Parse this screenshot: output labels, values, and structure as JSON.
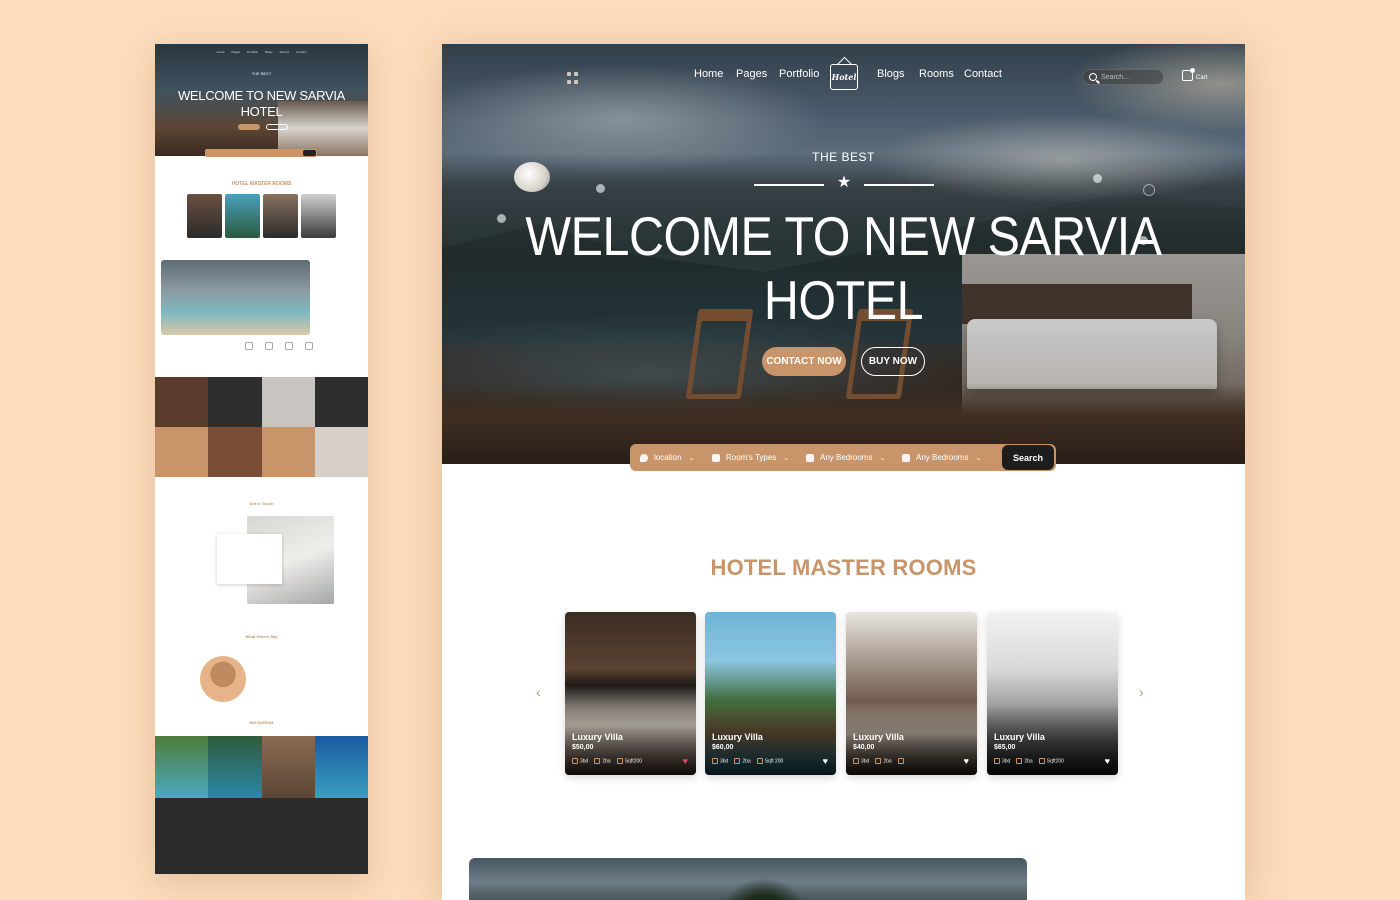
{
  "nav": {
    "links": [
      "Home",
      "Pages",
      "Portfolio",
      "Blogs",
      "Rooms",
      "Contact"
    ],
    "logo": "Hotel",
    "search_placeholder": "Search...",
    "cart_label": "Cart"
  },
  "hero": {
    "kicker": "THE BEST",
    "title_line1": "WELCOME TO NEW SARVIA",
    "title_line2": "HOTEL",
    "contact_button": "CONTACT NOW",
    "buy_button": "BUY NOW"
  },
  "booking": {
    "location": "location",
    "room_types": "Room's Types",
    "bedrooms_1": "Any Bedrooms",
    "bedrooms_2": "Any Bedrooms",
    "search_button": "Search"
  },
  "rooms_section": {
    "title": "HOTEL MASTER ROOMS",
    "cards": [
      {
        "name": "Luxury Villa",
        "price": "$50,00",
        "beds": "3bd",
        "people": "2ba",
        "area": "Sqft200",
        "favorite": true
      },
      {
        "name": "Luxury Villa",
        "price": "$60,00",
        "beds": "3bd",
        "people": "2ba",
        "area": "Sqft 200",
        "favorite": false
      },
      {
        "name": "Luxury Villa",
        "price": "$40,00",
        "beds": "3bd",
        "people": "2ba",
        "area": "",
        "favorite": false
      },
      {
        "name": "Luxury Villa",
        "price": "$65,00",
        "beds": "3bd",
        "people": "2ba",
        "area": "Sqft200",
        "favorite": false
      }
    ]
  },
  "preview": {
    "nav": [
      "Home",
      "Pages",
      "Portfolio",
      "Blogs",
      "Rooms",
      "Contact"
    ],
    "kicker": "THE BEST",
    "title_line1": "WELCOME TO NEW SARVIA",
    "title_line2": "HOTEL",
    "rooms_title": "HOTEL MASTER ROOMS",
    "touch_title": "Get in Touch",
    "testimonial_title": "What Others Say",
    "instagram_title": "INSTAGRAM"
  },
  "colors": {
    "accent": "#c8956a",
    "background": "#fbdcbc",
    "dark": "#1e1e1e"
  }
}
